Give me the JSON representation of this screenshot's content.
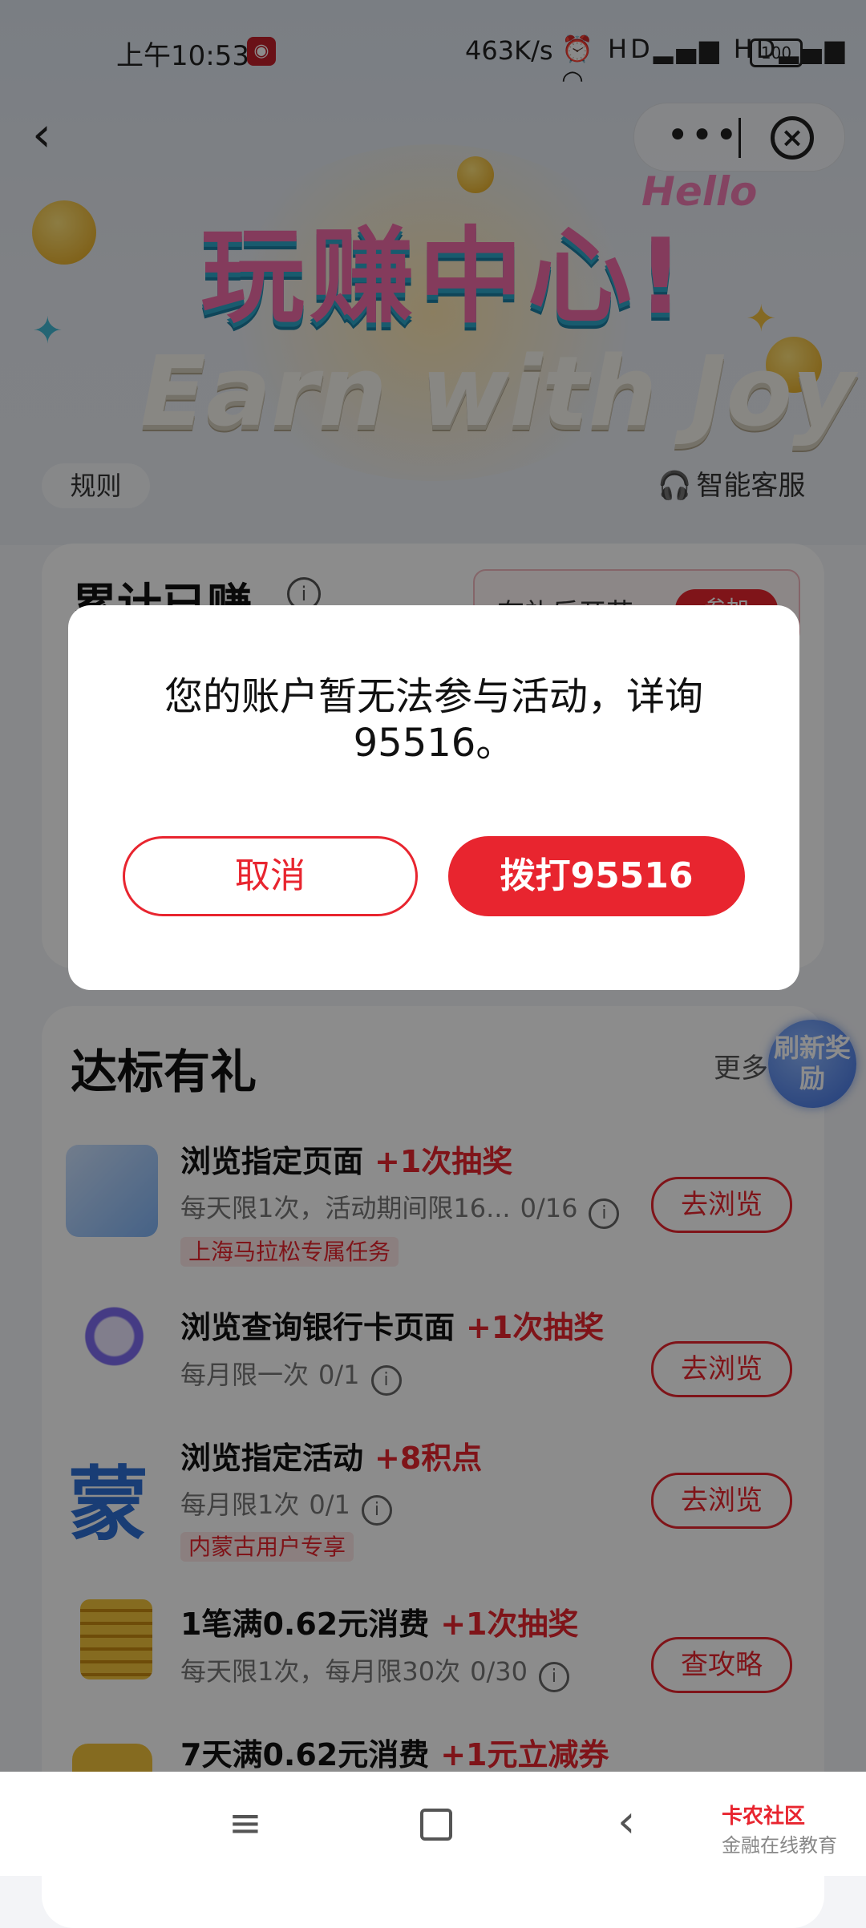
{
  "status_bar": {
    "time": "上午10:53",
    "network_speed": "463K/s",
    "signal_icons": "⏰ HD▂▄▆ HD▂▄▆ ◠",
    "battery": "100"
  },
  "header": {
    "back_icon": "chevron-left-icon",
    "more_icon": "more-dots-icon",
    "close_icon": "close-circle-icon"
  },
  "banner": {
    "title_cn": "玩赚中心!",
    "title_en": "Earn with Joy",
    "hello": "Hello",
    "rules_label": "规则",
    "service_label": "智能客服"
  },
  "earned_card": {
    "title": "累计已赚",
    "promo_text": "有礼乐开花",
    "join_label": "参加"
  },
  "tasks": {
    "title": "达标有礼",
    "more_label": "更多",
    "refresh_label": "刷新奖励",
    "items": [
      {
        "title": "浏览指定页面",
        "reward": "+1次抽奖",
        "subtitle": "每天限1次，活动期间限16...",
        "progress": "0/16",
        "tag": "上海马拉松专属任务",
        "button": "去浏览"
      },
      {
        "title": "浏览查询银行卡页面",
        "reward": "+1次抽奖",
        "subtitle": "每月限一次",
        "progress": "0/1",
        "tag": "",
        "button": "去浏览"
      },
      {
        "title": "浏览指定活动",
        "reward": "+8积点",
        "subtitle": "每月限1次",
        "progress": "0/1",
        "tag": "内蒙古用户专享",
        "button": "去浏览"
      },
      {
        "title": "1笔满0.62元消费",
        "reward": "+1次抽奖",
        "subtitle": "每天限1次，每月限30次",
        "progress": "0/30",
        "tag": "",
        "button": "查攻略"
      },
      {
        "title": "7天满0.62元消费",
        "reward": "+1元立减券",
        "subtitle": "",
        "progress": "",
        "tag": "",
        "button": ""
      }
    ]
  },
  "dialog": {
    "message_line1": "您的账户暂无法参与活动，详询",
    "message_line2": "95516。",
    "cancel_label": "取消",
    "call_label": "拨打95516"
  },
  "navbar": {
    "menu_icon": "menu-icon",
    "home_icon": "home-square-icon",
    "back_icon": "back-chevron-icon"
  },
  "watermark": {
    "brand": "卡农社区",
    "tagline": "金融在线教育"
  },
  "colors": {
    "accent": "#e8252f",
    "overlay": "rgba(0,0,0,0.45)"
  }
}
